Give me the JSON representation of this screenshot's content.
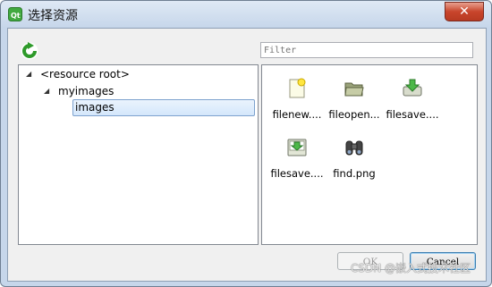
{
  "window": {
    "title": "选择资源",
    "close_label": "✕"
  },
  "filter": {
    "placeholder": "Filter",
    "value": ""
  },
  "tree": {
    "root": {
      "label": "<resource root>"
    },
    "child": {
      "label": "myimages"
    },
    "grandchild": {
      "label": "images",
      "selected": true
    }
  },
  "files": [
    {
      "label": "filenew....",
      "icon": "file-new-icon"
    },
    {
      "label": "fileopen...",
      "icon": "folder-open-icon"
    },
    {
      "label": "filesave....",
      "icon": "file-save-icon"
    },
    {
      "label": "filesave....",
      "icon": "file-save-as-icon"
    },
    {
      "label": "find.png",
      "icon": "binoculars-icon"
    }
  ],
  "buttons": {
    "ok": "OK",
    "cancel": "Cancel"
  },
  "watermark": "CSDN @嵌入式技术社区",
  "colors": {
    "accent": "#3c7fb1",
    "selection": "#d4e7fb",
    "reload_green": "#2e9a2a"
  }
}
